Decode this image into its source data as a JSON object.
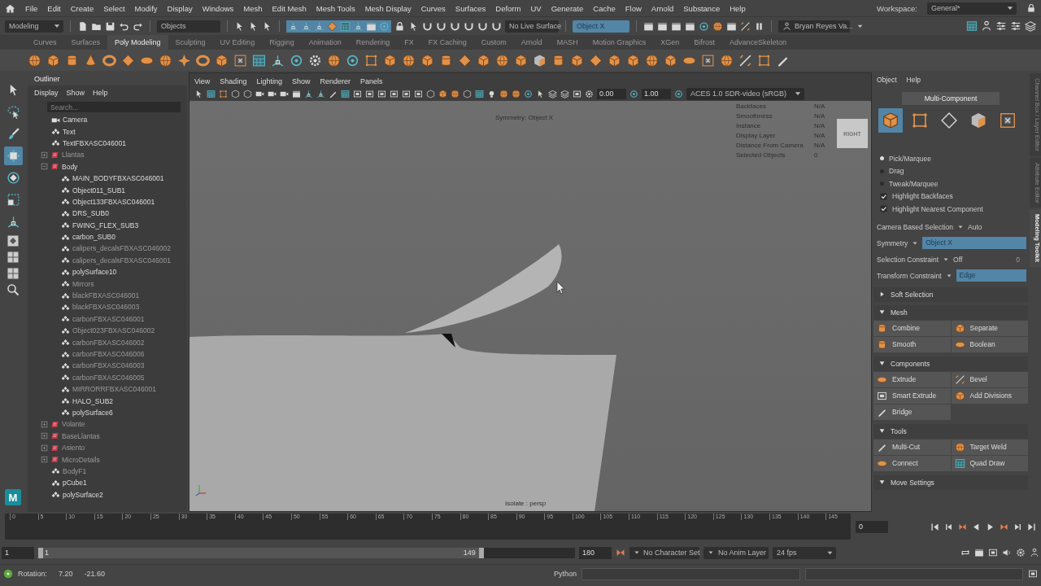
{
  "menu_bar": {
    "items": [
      "File",
      "Edit",
      "Create",
      "Select",
      "Modify",
      "Display",
      "Windows",
      "Mesh",
      "Edit Mesh",
      "Mesh Tools",
      "Mesh Display",
      "Curves",
      "Surfaces",
      "Deform",
      "UV",
      "Generate",
      "Cache",
      "Flow",
      "Arnold",
      "Substance",
      "Help"
    ],
    "workspace_label": "Workspace:",
    "workspace": "General*"
  },
  "status_line": {
    "menu_set": "Modeling",
    "selection_mode": "Objects",
    "live_surface": "No Live Surface",
    "symmetry": "Object X",
    "user": "Bryan Reyes Va..."
  },
  "shelf": {
    "tabs": [
      {
        "label": "Curves",
        "selected": false
      },
      {
        "label": "Surfaces",
        "selected": false
      },
      {
        "label": "Poly Modeling",
        "selected": true
      },
      {
        "label": "Sculpting",
        "selected": false
      },
      {
        "label": "UV Editing",
        "selected": false
      },
      {
        "label": "Rigging",
        "selected": false
      },
      {
        "label": "Animation",
        "selected": false
      },
      {
        "label": "Rendering",
        "selected": false
      },
      {
        "label": "FX",
        "selected": false
      },
      {
        "label": "FX Caching",
        "selected": false
      },
      {
        "label": "Custom",
        "selected": false
      },
      {
        "label": "Arnold",
        "selected": false
      },
      {
        "label": "MASH",
        "selected": false
      },
      {
        "label": "Motion Graphics",
        "selected": false
      },
      {
        "label": "XGen",
        "selected": false
      },
      {
        "label": "Bifrost",
        "selected": false
      },
      {
        "label": "AdvanceSkeleton",
        "selected": false
      }
    ]
  },
  "toolbox": {
    "tools": [
      {
        "selected": false
      },
      {
        "selected": false
      },
      {
        "selected": false
      },
      {
        "selected": true
      },
      {
        "selected": false
      },
      {
        "selected": false
      },
      {
        "selected": false
      }
    ],
    "logo": "M"
  },
  "outliner": {
    "title": "Outliner",
    "menu": [
      "Display",
      "Show",
      "Help"
    ],
    "search": {
      "placeholder": "Search..."
    },
    "items": [
      {
        "name": "Camera",
        "kind": "camera",
        "hidden": false
      },
      {
        "name": "Text",
        "kind": "mesh",
        "hidden": false
      },
      {
        "name": "TextFBXASC046001",
        "kind": "mesh",
        "hidden": false
      },
      {
        "name": "Llantas",
        "kind": "group",
        "hidden": true,
        "expanded": false
      },
      {
        "name": "Body",
        "kind": "group",
        "hidden": false,
        "expanded": true,
        "children": [
          {
            "name": "MAIN_BODYFBXASC046001",
            "kind": "mesh",
            "hidden": false
          },
          {
            "name": "Object011_SUB1",
            "kind": "mesh",
            "hidden": false
          },
          {
            "name": "Object133FBXASC046001",
            "kind": "mesh",
            "hidden": false
          },
          {
            "name": "DRS_SUB0",
            "kind": "mesh",
            "hidden": false
          },
          {
            "name": "FWING_FLEX_SUB3",
            "kind": "mesh",
            "hidden": false
          },
          {
            "name": "carbon_SUB0",
            "kind": "mesh",
            "hidden": false
          },
          {
            "name": "calipers_decalsFBXASC046002",
            "kind": "mesh",
            "hidden": true
          },
          {
            "name": "calipers_decalsFBXASC046001",
            "kind": "mesh",
            "hidden": true
          },
          {
            "name": "polySurface10",
            "kind": "mesh",
            "hidden": false
          },
          {
            "name": "Mirrors",
            "kind": "mesh",
            "hidden": true
          },
          {
            "name": "blackFBXASC046001",
            "kind": "mesh",
            "hidden": true
          },
          {
            "name": "blackFBXASC046003",
            "kind": "mesh",
            "hidden": true
          },
          {
            "name": "carbonFBXASC046001",
            "kind": "mesh",
            "hidden": true
          },
          {
            "name": "Object023FBXASC046002",
            "kind": "mesh",
            "hidden": true
          },
          {
            "name": "carbonFBXASC046002",
            "kind": "mesh",
            "hidden": true
          },
          {
            "name": "carbonFBXASC046006",
            "kind": "mesh",
            "hidden": true
          },
          {
            "name": "carbonFBXASC046003",
            "kind": "mesh",
            "hidden": true
          },
          {
            "name": "carbonFBXASC046005",
            "kind": "mesh",
            "hidden": true
          },
          {
            "name": "MIRRORRFBXASC046001",
            "kind": "mesh",
            "hidden": true
          },
          {
            "name": "HALO_SUB2",
            "kind": "mesh",
            "hidden": false
          },
          {
            "name": "polySurface6",
            "kind": "mesh",
            "hidden": false
          }
        ]
      },
      {
        "name": "Volante",
        "kind": "group",
        "hidden": true,
        "expanded": false
      },
      {
        "name": "BaseLlantas",
        "kind": "group",
        "hidden": true,
        "expanded": false
      },
      {
        "name": "Asiento",
        "kind": "group",
        "hidden": true,
        "expanded": false
      },
      {
        "name": "MicroDetails",
        "kind": "group",
        "hidden": true,
        "expanded": false
      },
      {
        "name": "BodyF1",
        "kind": "mesh",
        "hidden": true
      },
      {
        "name": "pCube1",
        "kind": "mesh",
        "hidden": false
      },
      {
        "name": "polySurface2",
        "kind": "mesh",
        "hidden": false
      }
    ]
  },
  "viewport": {
    "menu": [
      "View",
      "Shading",
      "Lighting",
      "Show",
      "Renderer",
      "Panels"
    ],
    "exposure": "0.00",
    "gamma": "1.00",
    "color_space": "ACES 1.0 SDR-video (sRGB)",
    "hud_symmetry": "Symmetry: Object X",
    "hud_rows": [
      {
        "label": "Backfaces",
        "value": "N/A"
      },
      {
        "label": "Smoothness",
        "value": "N/A"
      },
      {
        "label": "Instance",
        "value": "N/A"
      },
      {
        "label": "Display Layer",
        "value": "N/A"
      },
      {
        "label": "Distance From Camera",
        "value": "N/A"
      },
      {
        "label": "Selected Objects",
        "value": "0"
      }
    ],
    "view_cube": "RIGHT",
    "camera_label": "Isolate : persp"
  },
  "modeling_toolkit": {
    "menu": [
      "Object",
      "Help"
    ],
    "mode": "Multi-Component",
    "components": [
      {
        "selected": true
      },
      {
        "selected": false
      },
      {
        "selected": false
      },
      {
        "selected": false
      },
      {
        "selected": false
      }
    ],
    "pick_modes": [
      {
        "label": "Pick/Marquee",
        "selected": true
      },
      {
        "label": "Drag",
        "selected": false
      },
      {
        "label": "Tweak/Marquee",
        "selected": false
      }
    ],
    "options": [
      {
        "label": "Highlight Backfaces",
        "checked": true
      },
      {
        "label": "Highlight Nearest Component",
        "checked": true
      }
    ],
    "settings": [
      {
        "label": "Camera Based Selection",
        "value": "Auto",
        "kind": "text"
      },
      {
        "label": "Symmetry",
        "value": "Object X",
        "kind": "field"
      },
      {
        "label": "Selection Constraint",
        "value": "Off",
        "kind": "text",
        "extra": "0"
      },
      {
        "label": "Transform Constraint",
        "value": "Edge",
        "kind": "field"
      }
    ],
    "sections": [
      {
        "title": "Soft Selection",
        "expanded": false
      },
      {
        "title": "Mesh",
        "expanded": true,
        "tools": [
          "Combine",
          "Separate",
          "Smooth",
          "Boolean"
        ]
      },
      {
        "title": "Components",
        "expanded": true,
        "tools": [
          "Extrude",
          "Bevel",
          "Smart Extrude",
          "Add Divisions",
          "Bridge"
        ]
      },
      {
        "title": "Tools",
        "expanded": true,
        "tools": [
          "Multi-Cut",
          "Target Weld",
          "Connect",
          "Quad Draw"
        ]
      },
      {
        "title": "Move Settings",
        "expanded": true
      }
    ]
  },
  "side_tabs": [
    {
      "label": "Channel Box / Layer Editor",
      "selected": false
    },
    {
      "label": "Attribute Editor",
      "selected": false
    },
    {
      "label": "Modeling Toolkit",
      "selected": true
    }
  ],
  "time_slider": {
    "ticks": [
      "0",
      "5",
      "10",
      "15",
      "20",
      "25",
      "30",
      "35",
      "40",
      "45",
      "50",
      "55",
      "60",
      "65",
      "70",
      "75",
      "80",
      "85",
      "90",
      "95",
      "100",
      "105",
      "110",
      "115",
      "120",
      "125",
      "130",
      "135",
      "140",
      "145"
    ],
    "current_frame": "0"
  },
  "range_slider": {
    "start": "1",
    "range_start": "1",
    "range_end": "149",
    "end": "180",
    "character_set": "No Character Set",
    "anim_layer": "No Anim Layer",
    "fps": "24 fps"
  },
  "command_line": {
    "help_label": "Rotation:",
    "help_values": [
      "7.20",
      "-21.60"
    ],
    "language": "Python"
  }
}
